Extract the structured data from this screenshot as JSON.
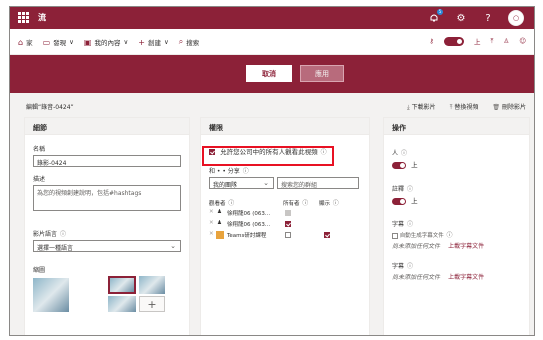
{
  "suite": {
    "app_title": "流",
    "notification_count": "5"
  },
  "nav": {
    "items": [
      {
        "label": "家",
        "icon": "home-icon"
      },
      {
        "label": "發現",
        "icon": "discover-icon",
        "chev": "∨"
      },
      {
        "label": "我的內容",
        "icon": "my-content-icon",
        "chev": "∨"
      },
      {
        "label": "創建",
        "icon": "plus-icon",
        "chev": "∨"
      },
      {
        "label": "搜索",
        "icon": "search-icon"
      }
    ],
    "right": {
      "up_label": "上"
    }
  },
  "actions": {
    "cancel_label": "取消",
    "apply_label": "應用"
  },
  "edit": {
    "title": "編輯“錄音-0424”",
    "download_label": "下載影片",
    "replace_label": "替換視頻",
    "delete_label": "刪除影片"
  },
  "details": {
    "header": "細節",
    "name_label": "名稱",
    "name_value": "錄影-0424",
    "desc_label": "描述",
    "desc_placeholder": "為您的視頻創建說明，包括#hashtags",
    "lang_label": "影片語言",
    "lang_value": "選擇一種語言",
    "thumb_label": "縮圖"
  },
  "permissions": {
    "header": "權限",
    "allow_all_label": "允許您公司中的所有人觀看此視頻",
    "share_label": "和 • • 分享",
    "share_scope": "我的團隊",
    "search_placeholder": "搜索您的群組",
    "col_viewer": "觀看者",
    "col_owner": "所有者",
    "col_display": "顯示",
    "rows": [
      {
        "name": "徐翔龍06 (063...",
        "owner": "disabled",
        "display": "none"
      },
      {
        "name": "徐翔龍06 (063...",
        "owner": "checked",
        "display": "none"
      },
      {
        "name": "Teams研討課程",
        "owner": "unchecked",
        "display": "checked"
      }
    ]
  },
  "options": {
    "header": "操作",
    "comments_label": "人",
    "comments_state": "上",
    "notes_label": "註釋",
    "notes_state": "上",
    "captions_label": "字幕",
    "autogen_label": "自動生成字幕文件",
    "no_caption": "尚未添加任何文件",
    "upload_caption": "上載字幕文件",
    "subtitles_label": "字幕",
    "no_subtitle": "尚未添加任何文件",
    "upload_subtitle": "上載字幕文件"
  },
  "colors": {
    "brand": "#8c2138",
    "highlight_border": "#e81123"
  }
}
